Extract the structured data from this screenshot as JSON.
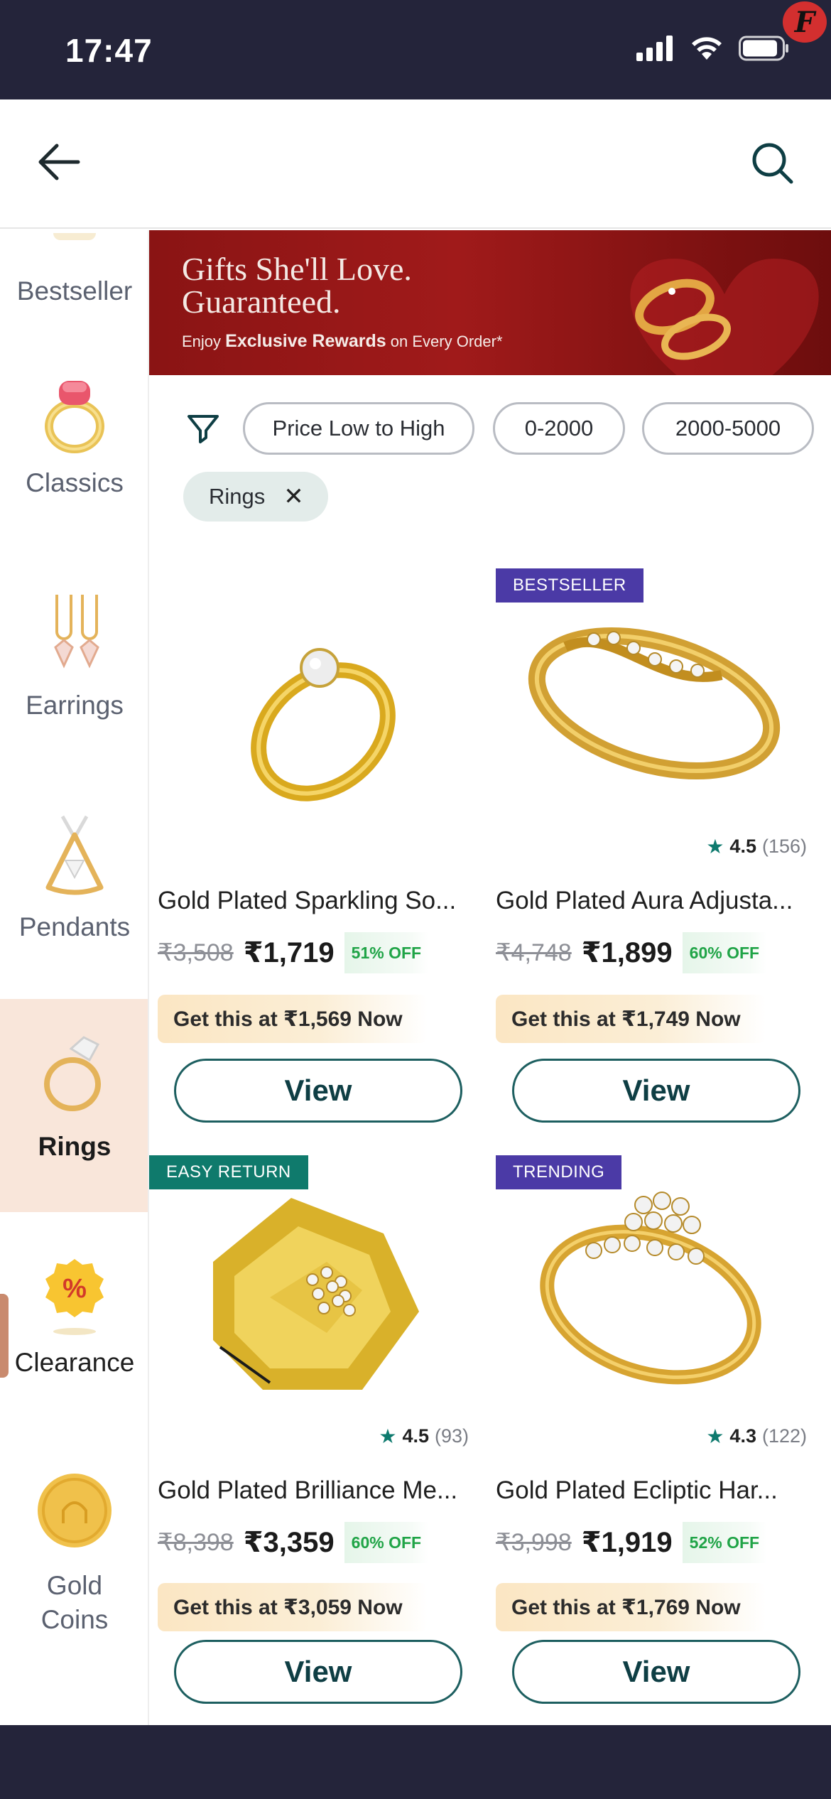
{
  "status_bar": {
    "time": "17:47",
    "badge": "F"
  },
  "header": {
    "back_icon": "arrow-left-icon",
    "search_icon": "search-icon"
  },
  "sidebar": {
    "items": [
      {
        "label": "Bestseller",
        "icon": "bestseller-icon"
      },
      {
        "label": "Classics",
        "icon": "ring-pink-stone-icon"
      },
      {
        "label": "Earrings",
        "icon": "earrings-icon"
      },
      {
        "label": "Pendants",
        "icon": "pendant-icon"
      },
      {
        "label": "Rings",
        "icon": "ring-icon",
        "active": true
      },
      {
        "label": "Clearance",
        "icon": "percent-badge-icon"
      },
      {
        "label": "Gold Coins",
        "icon": "gold-coin-icon"
      }
    ]
  },
  "banner": {
    "headline_1": "Gifts She'll Love.",
    "headline_2": "Guaranteed.",
    "sub_prefix": "Enjoy ",
    "sub_bold": "Exclusive Rewards",
    "sub_suffix": " on Every Order*"
  },
  "filters": {
    "chips": [
      "Price Low to High",
      "0-2000",
      "2000-5000"
    ],
    "applied_tag": "Rings"
  },
  "products": [
    {
      "tag": "",
      "title": "Gold Plated Sparkling So...",
      "mrp": "₹3,508",
      "price": "₹1,719",
      "off": "51% OFF",
      "deal": "Get this at ₹1,569 Now",
      "rating": "",
      "reviews": "",
      "button": "View"
    },
    {
      "tag": "BESTSELLER",
      "title": "Gold Plated Aura Adjusta...",
      "mrp": "₹4,748",
      "price": "₹1,899",
      "off": "60% OFF",
      "deal": "Get this at ₹1,749 Now",
      "rating": "4.5",
      "reviews": "(156)",
      "button": "View"
    },
    {
      "tag": "EASY RETURN",
      "title": "Gold Plated Brilliance Me...",
      "mrp": "₹8,398",
      "price": "₹3,359",
      "off": "60% OFF",
      "deal": "Get this at ₹3,059 Now",
      "rating": "4.5",
      "reviews": "(93)",
      "button": "View"
    },
    {
      "tag": "TRENDING",
      "title": "Gold Plated Ecliptic Har...",
      "mrp": "₹3,998",
      "price": "₹1,919",
      "off": "52% OFF",
      "deal": "Get this at ₹1,769 Now",
      "rating": "4.3",
      "reviews": "(122)",
      "button": "View"
    }
  ],
  "colors": {
    "status_bar": "#24243a",
    "bestseller_tag": "#4b3aa6",
    "easy_return_tag": "#0f7a6c",
    "trending_tag": "#4b3aa6",
    "accent_teal": "#1d5f60",
    "banner_red": "#8a1414"
  }
}
